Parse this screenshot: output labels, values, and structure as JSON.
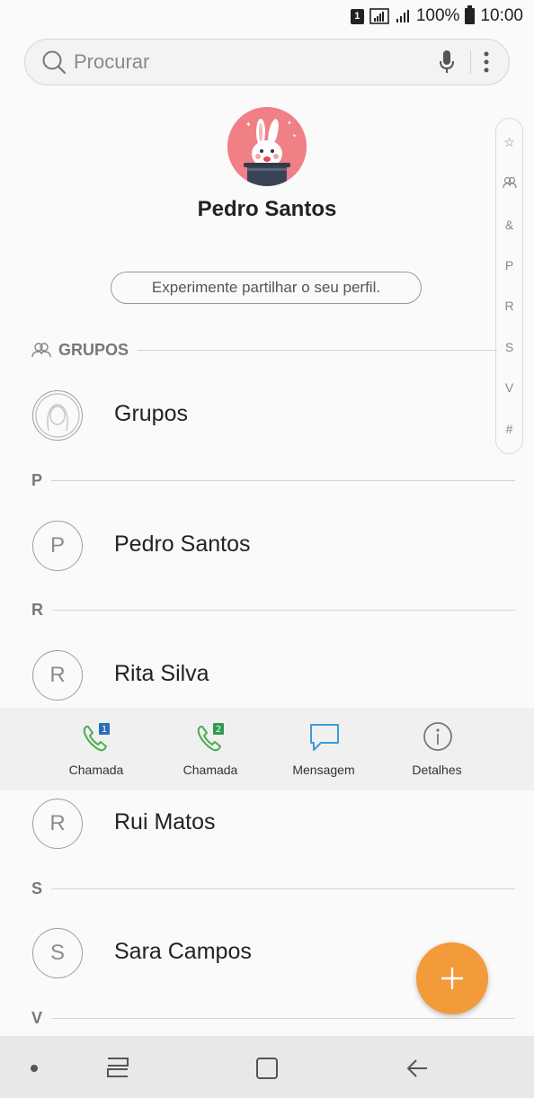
{
  "status_bar": {
    "sim_slot": "1",
    "battery_pct": "100%",
    "time": "10:00",
    "icons": [
      "sim-icon",
      "signal-sim1-icon",
      "signal-sim2-icon",
      "battery-icon"
    ]
  },
  "search": {
    "placeholder": "Procurar",
    "icons": [
      "search-icon",
      "mic-icon",
      "more-vert-icon"
    ]
  },
  "profile": {
    "name": "Pedro Santos",
    "share_prompt": "Experimente partilhar o seu perfil.",
    "avatar_icon": "bunny-in-hat-icon"
  },
  "index": [
    "☆",
    "groups",
    "&",
    "P",
    "R",
    "S",
    "V",
    "#"
  ],
  "sections": {
    "groups": "GRUPOS",
    "p": "P",
    "r": "R",
    "s": "S",
    "v": "V"
  },
  "contacts": {
    "groups_row": {
      "name": "Grupos",
      "icon": "group-avatar-icon"
    },
    "pedro": {
      "initial": "P",
      "name": "Pedro Santos"
    },
    "rita": {
      "initial": "R",
      "name": "Rita Silva"
    },
    "rui": {
      "initial": "R",
      "name": "Rui Matos"
    },
    "sara": {
      "initial": "S",
      "name": "Sara Campos"
    }
  },
  "actions": {
    "call1": {
      "label": "Chamada",
      "badge": "1",
      "badge_color": "#2b6fb8"
    },
    "call2": {
      "label": "Chamada",
      "badge": "2",
      "badge_color": "#2e9b53"
    },
    "message": {
      "label": "Mensagem"
    },
    "details": {
      "label": "Detalhes"
    }
  },
  "colors": {
    "accent_fab": "#f39a3b",
    "call_green": "#4caf50",
    "message_blue": "#3d9bd6"
  },
  "fab": {
    "icon": "plus-icon"
  },
  "nav_bar": {
    "icons": [
      "dot-icon",
      "recents-icon",
      "home-icon",
      "back-icon"
    ]
  }
}
